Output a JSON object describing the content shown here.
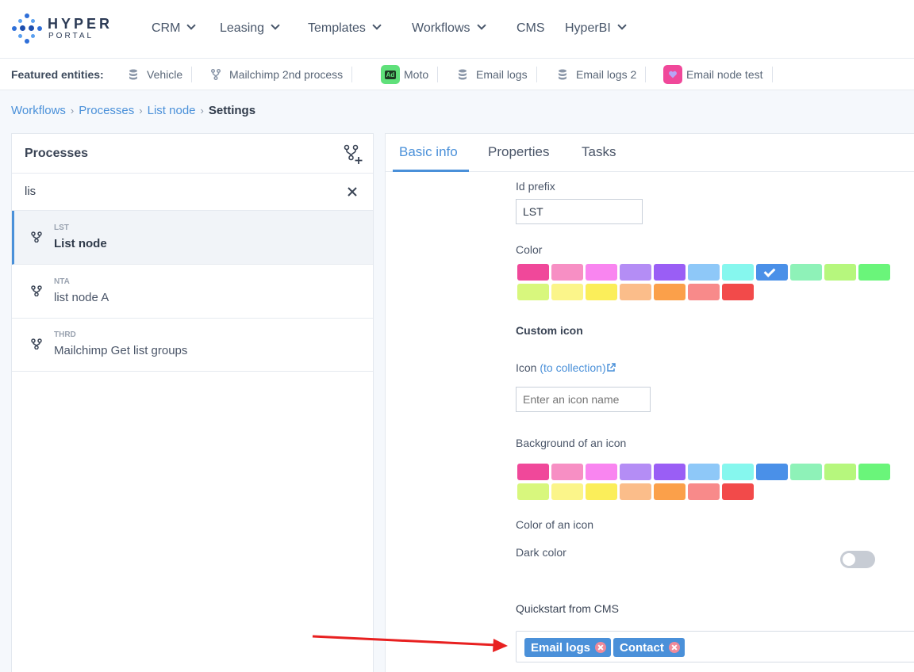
{
  "brand": {
    "line1": "HYPER",
    "line2": "PORTAL"
  },
  "nav": [
    {
      "label": "CRM",
      "dropdown": true
    },
    {
      "label": "Leasing",
      "dropdown": true
    },
    {
      "label": "Templates",
      "dropdown": true
    },
    {
      "label": "Workflows",
      "dropdown": true
    },
    {
      "label": "CMS",
      "dropdown": false
    },
    {
      "label": "HyperBI",
      "dropdown": true
    }
  ],
  "featured": {
    "label": "Featured entities:",
    "items": [
      {
        "label": "Vehicle",
        "icon": "database-icon"
      },
      {
        "label": "Mailchimp 2nd process",
        "icon": "process-icon"
      },
      {
        "label": "Moto",
        "icon": "ad-badge-icon",
        "badge_text": "Ad",
        "badge_color": "#5fe07a"
      },
      {
        "label": "Email logs",
        "icon": "database-icon"
      },
      {
        "label": "Email logs 2",
        "icon": "database-icon"
      },
      {
        "label": "Email node test",
        "icon": "heart-badge-icon",
        "badge_color": "#f0489a"
      }
    ]
  },
  "breadcrumb": {
    "items": [
      "Workflows",
      "Processes",
      "List node"
    ],
    "current": "Settings"
  },
  "processes": {
    "title": "Processes",
    "search_value": "lis",
    "items": [
      {
        "code": "LST",
        "name": "List node",
        "active": true
      },
      {
        "code": "NTA",
        "name": "list node A",
        "active": false
      },
      {
        "code": "THRD",
        "name": "Mailchimp Get list groups",
        "active": false
      }
    ]
  },
  "tabs": [
    {
      "label": "Basic info",
      "active": true
    },
    {
      "label": "Properties",
      "active": false
    },
    {
      "label": "Tasks",
      "active": false
    }
  ],
  "form": {
    "id_prefix_label": "Id prefix",
    "id_prefix_value": "LST",
    "color_label": "Color",
    "custom_icon_label": "Custom icon",
    "icon_label": "Icon",
    "icon_link": "(to collection)",
    "icon_placeholder": "Enter an icon name",
    "bg_label": "Background of an icon",
    "icon_color_label": "Color of an icon",
    "dark_color_label": "Dark color",
    "dark_color_on": false,
    "quickstart_label": "Quickstart from CMS",
    "quickstart_tags": [
      "Email logs",
      "Contact"
    ]
  },
  "palette": {
    "row1": [
      "#f0489a",
      "#f78fc4",
      "#f985f0",
      "#b48df5",
      "#9a5ef5",
      "#8ec8f8",
      "#86f7ee",
      "#4a90e8",
      "#8ef2b8",
      "#b6f77d",
      "#6af57a"
    ],
    "row2": [
      "#d8f77d",
      "#fbf58a",
      "#fbee5a",
      "#fbbd8a",
      "#fba04a",
      "#f88a8a",
      "#f24a4a"
    ],
    "selected_color_index": 7
  }
}
